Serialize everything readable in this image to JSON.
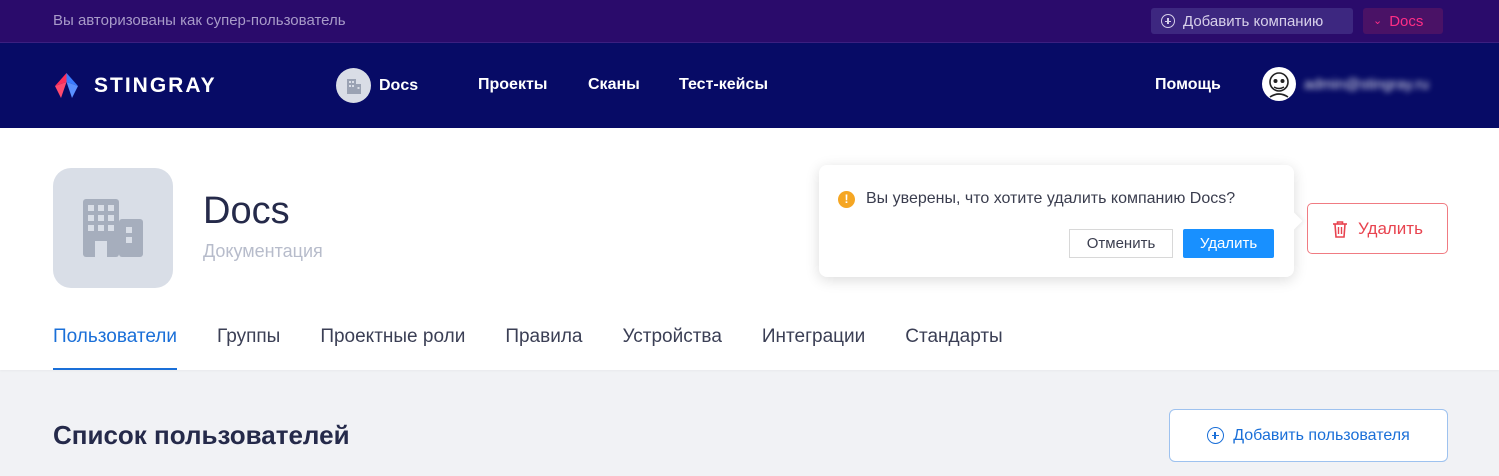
{
  "superuser_bar": {
    "notice": "Вы авторизованы как супер-пользователь",
    "add_company_label": "Добавить компанию",
    "current_company_label": "Docs"
  },
  "nav": {
    "logo_text": "STINGRAY",
    "company_name": "Docs",
    "links": [
      "Проекты",
      "Сканы",
      "Тест-кейсы"
    ],
    "help_label": "Помощь",
    "user_email": "admin@stingray.ru"
  },
  "company": {
    "name": "Docs",
    "description": "Документация",
    "delete_label": "Удалить"
  },
  "popconfirm": {
    "message": "Вы уверены, что хотите удалить компанию Docs?",
    "cancel_label": "Отменить",
    "confirm_label": "Удалить"
  },
  "tabs": [
    {
      "label": "Пользователи",
      "active": true
    },
    {
      "label": "Группы",
      "active": false
    },
    {
      "label": "Проектные роли",
      "active": false
    },
    {
      "label": "Правила",
      "active": false
    },
    {
      "label": "Устройства",
      "active": false
    },
    {
      "label": "Интеграции",
      "active": false
    },
    {
      "label": "Стандарты",
      "active": false
    }
  ],
  "users_section": {
    "title": "Список пользователей",
    "add_user_label": "Добавить пользователя"
  },
  "colors": {
    "superuser_bar": "#2a0b6b",
    "nav_bg": "#070b66",
    "accent": "#1a6fd8",
    "danger": "#e8434f",
    "primary_button": "#1890ff",
    "warning": "#f5a623"
  },
  "icons": {
    "logo": "stingray-logo-icon",
    "add_company": "plus-circle-icon",
    "company_switch": "chevron-down-icon",
    "company_avatar": "building-icon",
    "user_avatar": "avatar-icon",
    "delete": "trash-icon",
    "warning": "exclamation-circle-icon",
    "add_user": "plus-circle-icon"
  }
}
